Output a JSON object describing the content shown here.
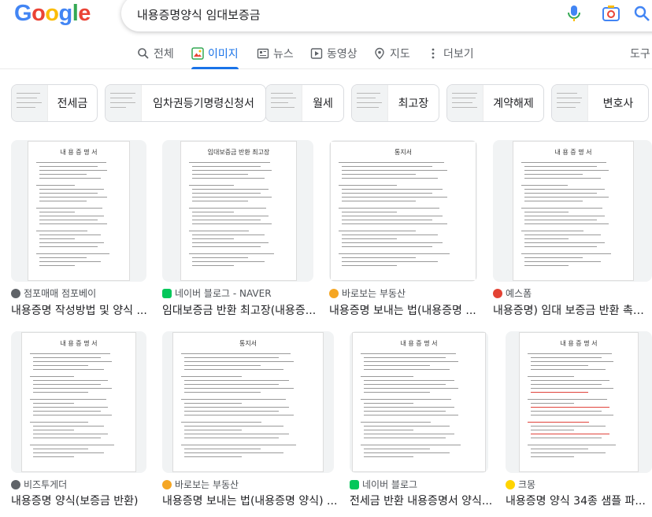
{
  "search": {
    "query": "내용증명양식 임대보증금"
  },
  "colors": {
    "accent": "#1a73e8",
    "logo": [
      "#4285F4",
      "#EA4335",
      "#FBBC05",
      "#4285F4",
      "#34A853",
      "#EA4335"
    ]
  },
  "logo_text": "Google",
  "tabs": [
    {
      "label": "전체",
      "icon": "search-icon"
    },
    {
      "label": "이미지",
      "icon": "image-icon",
      "active": true
    },
    {
      "label": "뉴스",
      "icon": "news-icon"
    },
    {
      "label": "동영상",
      "icon": "video-icon"
    },
    {
      "label": "지도",
      "icon": "map-pin-icon"
    },
    {
      "label": "더보기",
      "icon": "more-icon"
    }
  ],
  "tools_label": "도구",
  "chips": [
    "전세금",
    "임차권등기명령신청서",
    "월세",
    "최고장",
    "계약해제",
    "변호사"
  ],
  "results": [
    {
      "source": "점포매매 점포베이",
      "title": "내용증명 작성방법 및 양식 ...",
      "doc_title": "내 용 증 명 서",
      "favicon": "globe-icon"
    },
    {
      "source": "네이버 블로그 - NAVER",
      "title": "임대보증금 반환 최고장(내용증...",
      "doc_title": "임대보증금 반환 최고장",
      "favicon": "naver-icon"
    },
    {
      "source": "바로보는 부동산",
      "title": "내용증명 보내는 법(내용증명 ...",
      "doc_title": "통지서",
      "favicon": "search-q-icon"
    },
    {
      "source": "예스폼",
      "title": "내용증명) 임대 보증금 반환 촉구...",
      "doc_title": "내 용 증 명 서",
      "favicon": "yesform-icon"
    },
    {
      "source": "비즈투게더",
      "title": "내용증명 양식(보증금 반환)",
      "doc_title": "내 용 증 명 서",
      "favicon": "globe-icon"
    },
    {
      "source": "바로보는 부동산",
      "title": "내용증명 보내는 법(내용증명 양식) ...",
      "doc_title": "통지서",
      "favicon": "search-q-icon"
    },
    {
      "source": "네이버 블로그",
      "title": "전세금 반환 내용증명서 양식...",
      "doc_title": "내 용 증 명 서",
      "favicon": "naver-icon"
    },
    {
      "source": "크몽",
      "title": "내용증명 양식 34종 샘플 파...",
      "doc_title": "내 용 증 명 서",
      "favicon": "kmong-icon"
    }
  ]
}
